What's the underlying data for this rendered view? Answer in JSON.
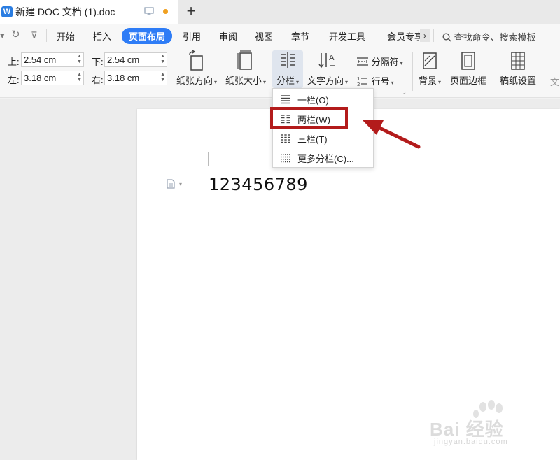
{
  "window": {
    "tab_title": "新建 DOC 文档 (1).doc",
    "logo": "W",
    "new_tab": "+"
  },
  "menu": {
    "items": [
      "开始",
      "插入",
      "页面布局",
      "引用",
      "审阅",
      "视图",
      "章节",
      "开发工具",
      "会员专享"
    ],
    "active": "页面布局",
    "more": "›",
    "search_placeholder": "查找命令、搜索模板"
  },
  "margins": {
    "top_label": "上:",
    "top_value": "2.54 cm",
    "bottom_label": "下:",
    "bottom_value": "2.54 cm",
    "left_label": "左:",
    "left_value": "3.18 cm",
    "right_label": "右:",
    "right_value": "3.18 cm"
  },
  "toolbar": {
    "orientation": "纸张方向",
    "size": "纸张大小",
    "columns": "分栏",
    "text_direction": "文字方向",
    "separator": "分隔符",
    "line_number": "行号",
    "background": "背景",
    "page_border": "页面边框",
    "manuscript": "稿纸设置",
    "more_cut": "文"
  },
  "columns_menu": {
    "items": [
      "一栏(O)",
      "两栏(W)",
      "三栏(T)",
      "更多分栏(C)..."
    ],
    "highlighted": "两栏(W)"
  },
  "document": {
    "text": "123456789"
  },
  "watermark": {
    "brand": "Bai 经验",
    "url": "jingyan.baidu.com"
  },
  "colors": {
    "accent": "#2e7cf6",
    "highlight": "#b31b1b",
    "unsaved": "#f0a020"
  }
}
